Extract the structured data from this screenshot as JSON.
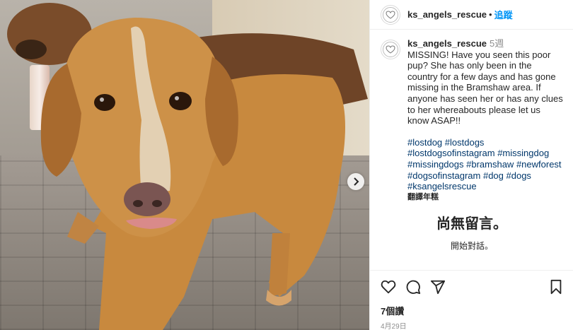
{
  "post": {
    "username": "ks_angels_rescue",
    "follow_label": "追蹤",
    "caption_time": "5週",
    "caption_text": "MISSING! Have you seen this poor pup? She has only been in the country for a few days and has gone missing in the Bramshaw area. If anyone has seen her or has any clues to her whereabouts please let us know ASAP!!",
    "hashtags": [
      "#lostdog",
      "#lostdogs",
      "#lostdogsofinstagram",
      "#missingdog",
      "#missingdogs",
      "#bramshaw",
      "#newforest",
      "#dogsofinstagram",
      "#dog",
      "#dogs",
      "#ksangelsrescue"
    ],
    "translate_label": "翻譯年糕",
    "no_comments_title": "尚無留言。",
    "no_comments_sub": "開始對話。",
    "views": "7個讚",
    "date": "4月29日"
  },
  "icons": {
    "like": "heart-icon",
    "comment": "comment-icon",
    "share": "send-icon",
    "save": "bookmark-icon",
    "next": "chevron-right-icon"
  },
  "colors": {
    "link": "#0095f6",
    "hashtag": "#00376b"
  }
}
